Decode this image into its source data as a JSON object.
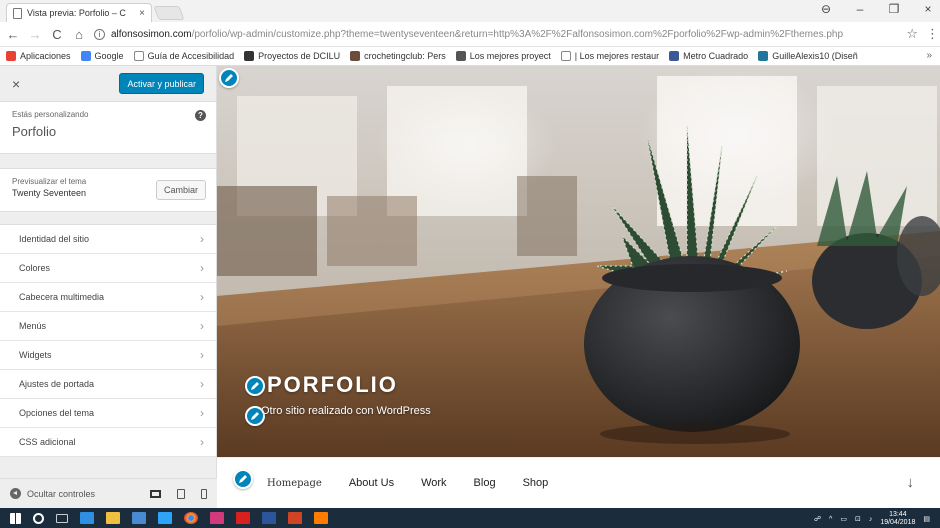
{
  "browser": {
    "tab_title": "Vista previa: Porfolio – C",
    "tab_close": "×",
    "window_controls": [
      "⊖",
      "–",
      "❐",
      "×"
    ],
    "url_host": "alfonsosimon.com",
    "url_rest": "/porfolio/wp-admin/customize.php?theme=twentyseventeen&return=http%3A%2F%2Falfonsosimon.com%2Fporfolio%2Fwp-admin%2Fthemes.php",
    "bookmarks": [
      {
        "label": "Aplicaciones",
        "icon": "apps-grid-icon",
        "color": "#e94235"
      },
      {
        "label": "Google",
        "icon": "google-icon",
        "color": "#4285f4"
      },
      {
        "label": "Guía de Accesibilidad",
        "icon": "page-icon",
        "color": "#ffffff"
      },
      {
        "label": "Proyectos de DCILU",
        "icon": "dark-app-icon",
        "color": "#333333"
      },
      {
        "label": "crochetingclub: Pers",
        "icon": "crochet-icon",
        "color": "#6b4b3a"
      },
      {
        "label": "Los mejores proyect",
        "icon": "flipboard-icon",
        "color": "#555555"
      },
      {
        "label": "| Los mejores restaur",
        "icon": "page-icon",
        "color": "#ffffff"
      },
      {
        "label": "Metro Cuadrado",
        "icon": "facebook-icon",
        "color": "#3b5998"
      },
      {
        "label": "GuilleAlexis10 (Diseñ",
        "icon": "wordpress-icon",
        "color": "#21759b"
      }
    ],
    "bookmarks_more": "»"
  },
  "sidebar": {
    "close": "×",
    "publish_label": "Activar y publicar",
    "customizing_label": "Estás personalizando",
    "site_name": "Porfolio",
    "preview_theme_label": "Previsualizar el tema",
    "theme_name": "Twenty Seventeen",
    "change_label": "Cambiar",
    "items": [
      {
        "label": "Identidad del sitio"
      },
      {
        "label": "Colores"
      },
      {
        "label": "Cabecera multimedia"
      },
      {
        "label": "Menús"
      },
      {
        "label": "Widgets"
      },
      {
        "label": "Ajustes de portada"
      },
      {
        "label": "Opciones del tema"
      },
      {
        "label": "CSS adicional"
      }
    ],
    "chevron": "›",
    "hide_controls": "Ocultar controles"
  },
  "preview": {
    "site_title": "PORFOLIO",
    "site_description": "Otro sitio realizado con WordPress",
    "nav": [
      "Homepage",
      "About Us",
      "Work",
      "Blog",
      "Shop"
    ],
    "scroll_arrow": "↓"
  },
  "taskbar": {
    "clock_time": "13:44",
    "clock_date": "19/04/2018",
    "icons": [
      {
        "name": "windows-start-icon",
        "color": "#ffffff"
      },
      {
        "name": "search-circle-icon",
        "color": "#ffffff"
      },
      {
        "name": "task-view-icon",
        "color": "#cccccc"
      },
      {
        "name": "edge-icon",
        "color": "#2f8fe0"
      },
      {
        "name": "file-explorer-icon",
        "color": "#f0c040"
      },
      {
        "name": "store-icon",
        "color": "#4a8ad0"
      },
      {
        "name": "photoshop-icon",
        "color": "#2fa3f7"
      },
      {
        "name": "chrome-icon",
        "color": "#e9b12b"
      },
      {
        "name": "indesign-icon",
        "color": "#d23a7b"
      },
      {
        "name": "acrobat-icon",
        "color": "#d8201e"
      },
      {
        "name": "word-icon",
        "color": "#2b579a"
      },
      {
        "name": "powerpoint-icon",
        "color": "#d04423"
      },
      {
        "name": "illustrator-icon",
        "color": "#ff7c00"
      }
    ]
  },
  "colors": {
    "accent": "#0085ba",
    "taskbar": "#1b2c3c"
  }
}
